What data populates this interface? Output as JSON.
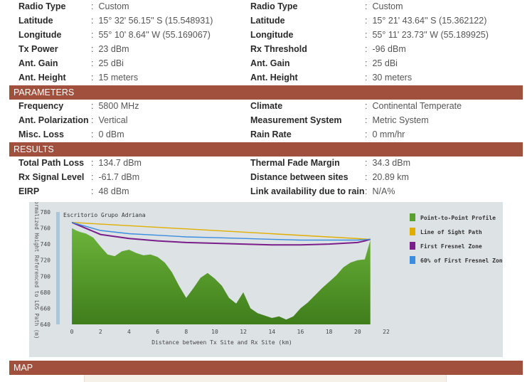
{
  "site_a": {
    "radio_type": {
      "label": "Radio Type",
      "value": "Custom"
    },
    "latitude": {
      "label": "Latitude",
      "value": "15° 32' 56.15'' S (15.548931)"
    },
    "longitude": {
      "label": "Longitude",
      "value": "55° 10' 8.64'' W (55.169067)"
    },
    "tx_power": {
      "label": "Tx Power",
      "value": "23 dBm"
    },
    "ant_gain": {
      "label": "Ant. Gain",
      "value": "25 dBi"
    },
    "ant_height": {
      "label": "Ant. Height",
      "value": "15 meters"
    }
  },
  "site_b": {
    "radio_type": {
      "label": "Radio Type",
      "value": "Custom"
    },
    "latitude": {
      "label": "Latitude",
      "value": "15° 21' 43.64'' S (15.362122)"
    },
    "longitude": {
      "label": "Longitude",
      "value": "55° 11' 23.73'' W (55.189925)"
    },
    "rx_threshold": {
      "label": "Rx Threshold",
      "value": "-96 dBm"
    },
    "ant_gain": {
      "label": "Ant. Gain",
      "value": "25 dBi"
    },
    "ant_height": {
      "label": "Ant. Height",
      "value": "30 meters"
    }
  },
  "parameters": {
    "title": "PARAMETERS",
    "frequency": {
      "label": "Frequency",
      "value": "5800 MHz"
    },
    "polarization": {
      "label": "Ant. Polarization",
      "value": "Vertical"
    },
    "misc_loss": {
      "label": "Misc. Loss",
      "value": "0 dBm"
    },
    "climate": {
      "label": "Climate",
      "value": "Continental Temperate"
    },
    "measurement": {
      "label": "Measurement System",
      "value": "Metric System"
    },
    "rain_rate": {
      "label": "Rain Rate",
      "value": "0 mm/hr"
    }
  },
  "results": {
    "title": "RESULTS",
    "path_loss": {
      "label": "Total Path Loss",
      "value": "134.7 dBm"
    },
    "rx_level": {
      "label": "Rx Signal Level",
      "value": "-61.7 dBm"
    },
    "eirp": {
      "label": "EIRP",
      "value": "48 dBm"
    },
    "fade_margin": {
      "label": "Thermal Fade Margin",
      "value": "34.3 dBm"
    },
    "distance": {
      "label": "Distance between sites",
      "value": "20.89 km"
    },
    "availability": {
      "label": "Link availability due to rain",
      "value": "N/A%"
    }
  },
  "map": {
    "title": "MAP"
  },
  "chart_data": {
    "type": "area",
    "site_label": "Escritorio Grupo Adriana",
    "xlabel": "Distance between Tx Site and Rx Site (km)",
    "ylabel": "Normalized Height Referenced to LOS Path (m)",
    "xlim": [
      -1,
      22
    ],
    "ylim": [
      640,
      780
    ],
    "xticks": [
      0,
      2,
      4,
      6,
      8,
      10,
      12,
      14,
      16,
      18,
      20,
      22
    ],
    "yticks": [
      640,
      660,
      680,
      700,
      720,
      740,
      760,
      780
    ],
    "legend_position": "right",
    "series": [
      {
        "name": "Point-to-Point Profile",
        "color": "#5aa02c",
        "x": [
          0,
          0.3,
          0.6,
          1,
          1.5,
          2,
          2.5,
          3,
          3.5,
          4,
          4.5,
          5,
          5.5,
          6,
          6.5,
          7,
          7.5,
          8,
          8.5,
          9,
          9.5,
          10,
          10.5,
          11,
          11.5,
          12,
          12.5,
          13,
          13.5,
          14,
          14.5,
          15,
          15.5,
          16,
          16.5,
          17,
          17.5,
          18,
          18.5,
          19,
          19.5,
          20,
          20.5,
          20.89
        ],
        "values": [
          760,
          757,
          755,
          753,
          748,
          737,
          727,
          725,
          731,
          733,
          729,
          726,
          727,
          724,
          717,
          705,
          688,
          673,
          685,
          698,
          704,
          697,
          688,
          673,
          666,
          680,
          660,
          654,
          651,
          648,
          650,
          646,
          650,
          660,
          667,
          676,
          685,
          693,
          701,
          711,
          717,
          720,
          721,
          745
        ]
      },
      {
        "name": "Line of Sight Path",
        "color": "#e0ae00",
        "x": [
          0,
          20.89
        ],
        "values": [
          767,
          746
        ]
      },
      {
        "name": "First Fresnel Zone",
        "color": "#7a1e8a",
        "x": [
          0,
          2,
          4,
          6,
          8,
          10,
          12,
          14,
          16,
          18,
          19,
          20,
          20.5,
          20.89
        ],
        "values": [
          767,
          752,
          747,
          744,
          742,
          741,
          740,
          739,
          739,
          740,
          741,
          742,
          744,
          746
        ]
      },
      {
        "name": "60% of First Fresnel Zone",
        "color": "#3b8de0",
        "x": [
          0,
          2,
          4,
          6,
          8,
          10,
          12,
          14,
          16,
          18,
          20,
          20.89
        ],
        "values": [
          767,
          757,
          753,
          751,
          749,
          748,
          747,
          746,
          745,
          745,
          745,
          746
        ]
      }
    ]
  }
}
